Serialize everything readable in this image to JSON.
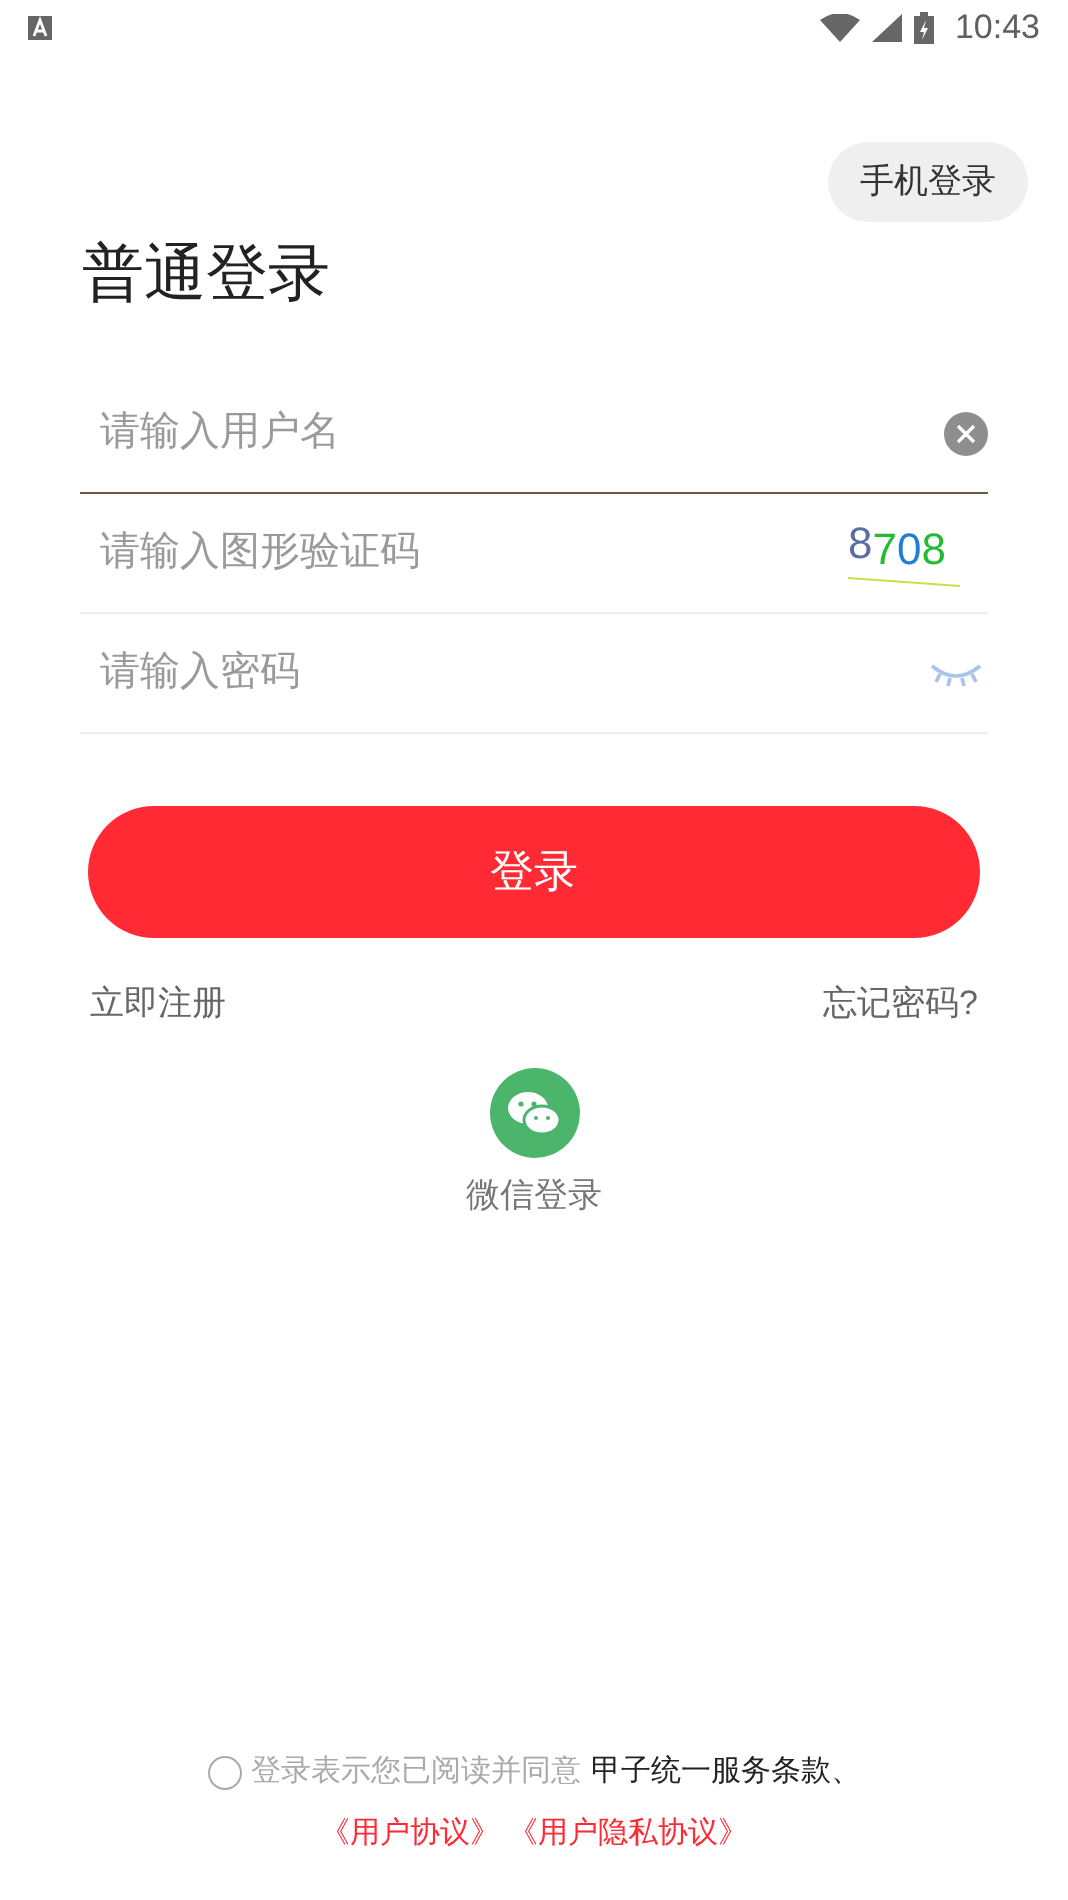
{
  "status_bar": {
    "time": "10:43"
  },
  "phone_login_button": "手机登录",
  "title": "普通登录",
  "fields": [
    {
      "kind": "clear",
      "placeholder": "请输入用户名",
      "focused": true
    },
    {
      "kind": "captcha",
      "placeholder": "请输入图形验证码",
      "focused": false,
      "captcha": [
        {
          "text": "8",
          "color": "#5a6fa0"
        },
        {
          "text": "7",
          "color": "#22bb33"
        },
        {
          "text": "0",
          "color": "#1f7fd6"
        },
        {
          "text": "8",
          "color": "#22bb33"
        }
      ]
    },
    {
      "kind": "password",
      "placeholder": "请输入密码",
      "focused": false
    }
  ],
  "login_button": "登录",
  "register_link": "立即注册",
  "forgot_link": "忘记密码?",
  "wechat_login": "微信登录",
  "agreement": {
    "checked": false,
    "text": "登录表示您已阅读并同意",
    "terms": "甲子统一服务条款、",
    "links": [
      "《用户协议》",
      "《用户隐私协议》"
    ]
  }
}
